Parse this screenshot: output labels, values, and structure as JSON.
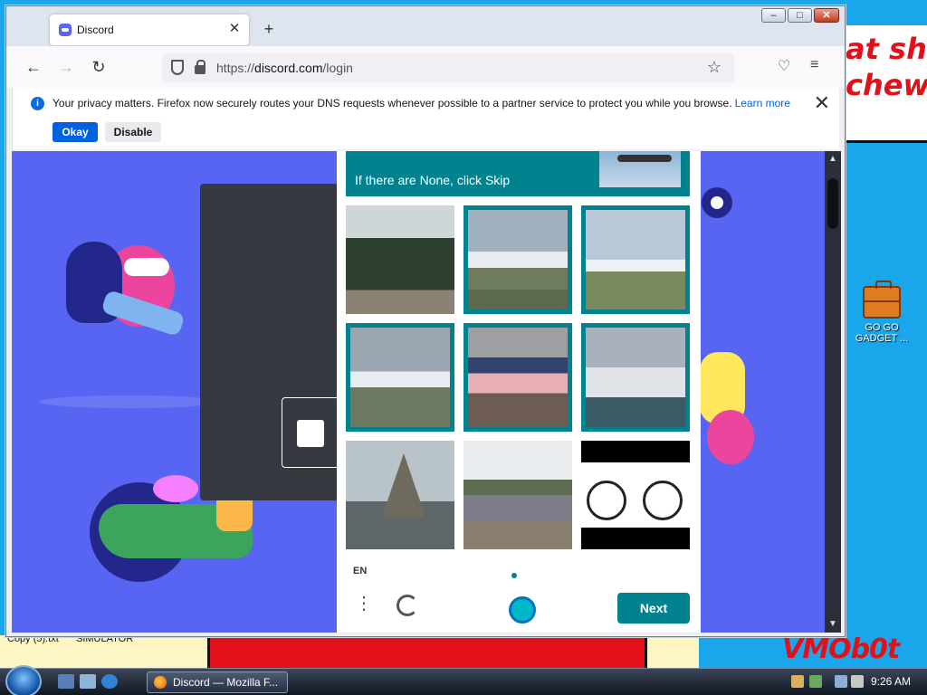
{
  "wallpaper": {
    "top_text": "at shit\nchew",
    "bottom_text": "VMOb0t"
  },
  "desktop": {
    "icon_label": "GO GO GADGET ...",
    "file_labels": [
      "Copy (5).txt",
      "SIMULATOR"
    ]
  },
  "browser": {
    "tab_title": "Discord",
    "url_prefix": "https://",
    "url_host": "discord.com",
    "url_path": "/login",
    "notification": {
      "message": "Your privacy matters. Firefox now securely routes your DNS requests whenever possible to a partner service to protect you while you browse.",
      "learn_more": "Learn more",
      "okay": "Okay",
      "disable": "Disable"
    }
  },
  "captcha": {
    "instruction": "If there are None, click Skip",
    "language": "EN",
    "next_label": "Next",
    "tiles": [
      {
        "subject": "train",
        "selected": false
      },
      {
        "subject": "airplane",
        "selected": true
      },
      {
        "subject": "airplane",
        "selected": true
      },
      {
        "subject": "airplane",
        "selected": true
      },
      {
        "subject": "airplane",
        "selected": true
      },
      {
        "subject": "airplane",
        "selected": true
      },
      {
        "subject": "sailboat",
        "selected": false
      },
      {
        "subject": "train",
        "selected": false
      },
      {
        "subject": "bicycle",
        "selected": false
      }
    ]
  },
  "taskbar": {
    "task_label": "Discord — Mozilla F...",
    "clock": "9:26 AM"
  },
  "colors": {
    "discord_blurple": "#5865f2",
    "captcha_teal": "#00838f",
    "firefox_blue": "#0061e0"
  }
}
